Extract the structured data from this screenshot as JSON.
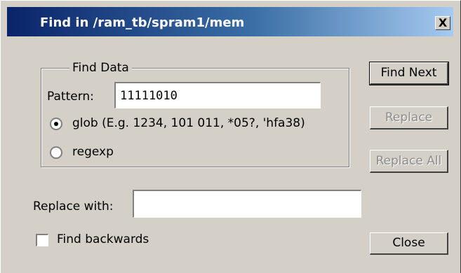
{
  "window": {
    "title": "Find in /ram_tb/spram1/mem",
    "close_glyph": "X"
  },
  "find_data": {
    "legend": "Find Data",
    "pattern_label": "Pattern:",
    "pattern_value": "11111010",
    "options": [
      {
        "label": "glob (E.g. 1234, 101 011, *05?, 'hfa38)",
        "checked": true
      },
      {
        "label": "regexp",
        "checked": false
      }
    ]
  },
  "replace": {
    "label": "Replace with:",
    "value": ""
  },
  "find_backwards": {
    "label": "Find backwards",
    "checked": false
  },
  "buttons": {
    "find_next": "Find Next",
    "replace": "Replace",
    "replace_all": "Replace All",
    "close": "Close"
  }
}
